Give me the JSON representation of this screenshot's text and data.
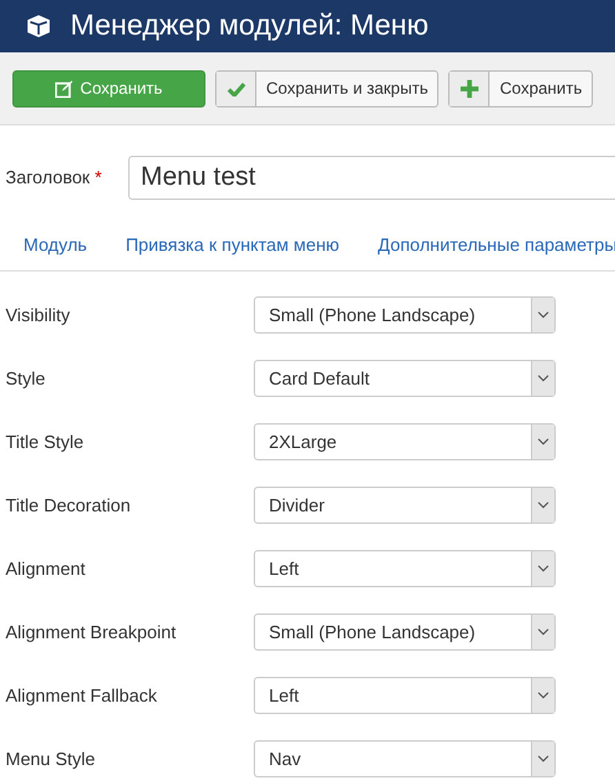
{
  "header": {
    "title": "Менеджер модулей: Меню"
  },
  "toolbar": [
    {
      "kind": "primary",
      "label": "Сохранить"
    },
    {
      "kind": "check",
      "label": "Сохранить и закрыть"
    },
    {
      "kind": "plus",
      "label": "Сохранить"
    }
  ],
  "title_field": {
    "label": "Заголовок",
    "required_mark": "*",
    "value": "Menu test"
  },
  "tabs": [
    {
      "label": "Модуль"
    },
    {
      "label": "Привязка к пунктам меню"
    },
    {
      "label": "Дополнительные параметры"
    }
  ],
  "fields": [
    {
      "label": "Visibility",
      "value": "Small (Phone Landscape)"
    },
    {
      "label": "Style",
      "value": "Card Default"
    },
    {
      "label": "Title Style",
      "value": "2XLarge"
    },
    {
      "label": "Title Decoration",
      "value": "Divider"
    },
    {
      "label": "Alignment",
      "value": "Left"
    },
    {
      "label": "Alignment Breakpoint",
      "value": "Small (Phone Landscape)"
    },
    {
      "label": "Alignment Fallback",
      "value": "Left"
    },
    {
      "label": "Menu Style",
      "value": "Nav"
    }
  ]
}
